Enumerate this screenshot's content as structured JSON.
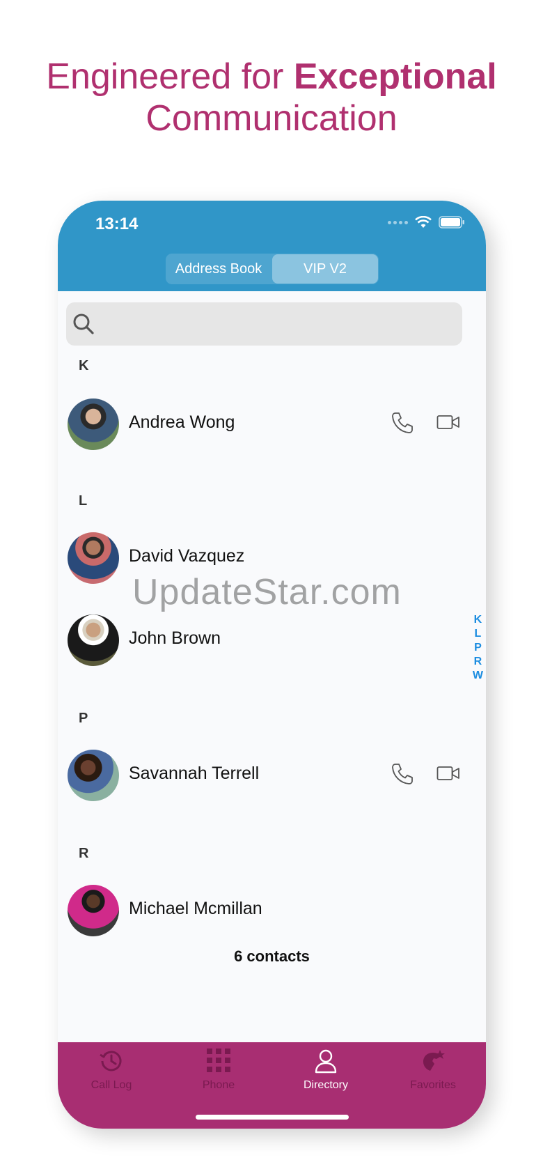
{
  "headline": {
    "prefix": "Engineered for ",
    "bold": "Exceptional",
    "line2": "Communication"
  },
  "status": {
    "time": "13:14"
  },
  "segments": [
    {
      "label": "Address Book",
      "active": false
    },
    {
      "label": "VIP V2",
      "active": true
    }
  ],
  "search": {
    "placeholder": ""
  },
  "sections": [
    {
      "letter": "K",
      "contacts": [
        {
          "name": "Andrea Wong",
          "actions": true
        }
      ]
    },
    {
      "letter": "L",
      "contacts": [
        {
          "name": "David Vazquez",
          "actions": false
        },
        {
          "name": "John Brown",
          "actions": false
        }
      ]
    },
    {
      "letter": "P",
      "contacts": [
        {
          "name": "Savannah Terrell",
          "actions": true
        }
      ]
    },
    {
      "letter": "R",
      "contacts": [
        {
          "name": "Michael Mcmillan",
          "actions": false
        }
      ]
    }
  ],
  "index_letters": [
    "K",
    "L",
    "P",
    "R",
    "W"
  ],
  "contact_count": "6 contacts",
  "tabs": [
    {
      "label": "Call Log",
      "icon": "clock-history-icon",
      "active": false
    },
    {
      "label": "Phone",
      "icon": "dialpad-icon",
      "active": false
    },
    {
      "label": "Directory",
      "icon": "person-icon",
      "active": true
    },
    {
      "label": "Favorites",
      "icon": "phone-star-icon",
      "active": false
    }
  ],
  "watermark": "UpdateStar.com",
  "colors": {
    "headline": "#b0306f",
    "topbar": "#3096c8",
    "tabbar": "#a82e72",
    "index": "#1a8ce0"
  }
}
